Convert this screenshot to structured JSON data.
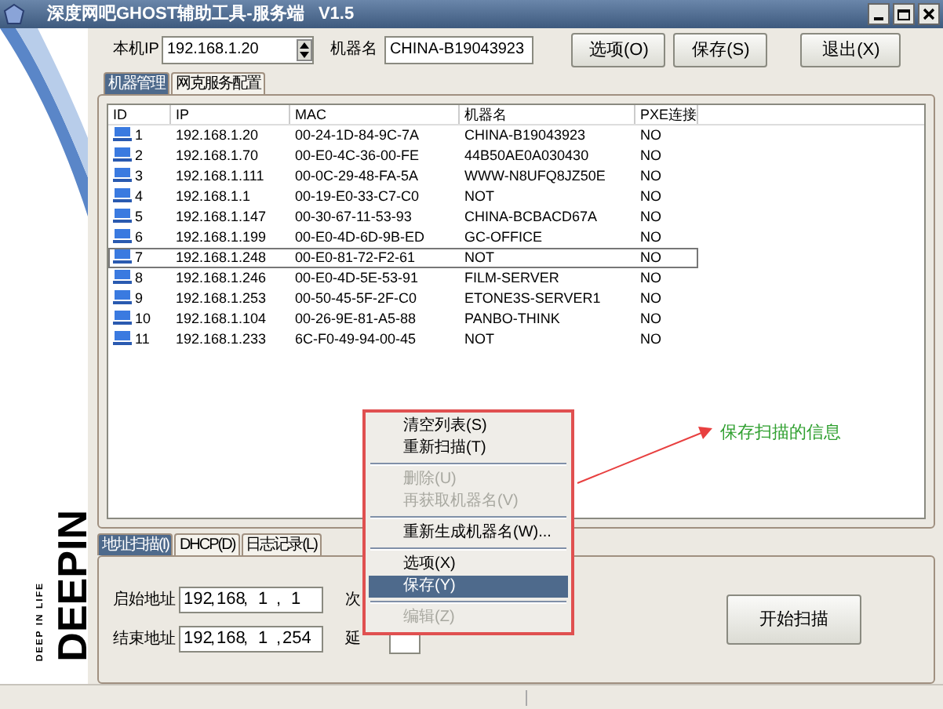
{
  "window": {
    "title": "深度网吧GHOST辅助工具-服务端   V1.5"
  },
  "banner": {
    "brand": "DEEPIN",
    "tagline": "DEEP IN LIFE"
  },
  "toolbar": {
    "local_ip_label": "本机IP",
    "local_ip": "192.168.1.20",
    "machine_name_label": "机器名",
    "machine_name": "CHINA-B19043923",
    "buttons": [
      "选项(O)",
      "保存(S)",
      "退出(X)"
    ]
  },
  "tabs": [
    {
      "label": "机器管理",
      "selected": true
    },
    {
      "label": "网克服务配置",
      "selected": false
    }
  ],
  "table": {
    "columns": [
      "ID",
      "IP",
      "MAC",
      "机器名",
      "PXE连接"
    ],
    "rows": [
      {
        "cells": [
          "1",
          "192.168.1.20",
          "00-24-1D-84-9C-7A",
          "CHINA-B19043923",
          "NO"
        ],
        "selected": false
      },
      {
        "cells": [
          "2",
          "192.168.1.70",
          "00-E0-4C-36-00-FE",
          "44B50AE0A030430",
          "NO"
        ],
        "selected": false
      },
      {
        "cells": [
          "3",
          "192.168.1.111",
          "00-0C-29-48-FA-5A",
          "WWW-N8UFQ8JZ50E",
          "NO"
        ],
        "selected": false
      },
      {
        "cells": [
          "4",
          "192.168.1.1",
          "00-19-E0-33-C7-C0",
          "NOT",
          "NO"
        ],
        "selected": false
      },
      {
        "cells": [
          "5",
          "192.168.1.147",
          "00-30-67-11-53-93",
          "CHINA-BCBACD67A",
          "NO"
        ],
        "selected": false
      },
      {
        "cells": [
          "6",
          "192.168.1.199",
          "00-E0-4D-6D-9B-ED",
          "GC-OFFICE",
          "NO"
        ],
        "selected": false
      },
      {
        "cells": [
          "7",
          "192.168.1.248",
          "00-E0-81-72-F2-61",
          "NOT",
          "NO"
        ],
        "selected": true
      },
      {
        "cells": [
          "8",
          "192.168.1.246",
          "00-E0-4D-5E-53-91",
          "FILM-SERVER",
          "NO"
        ],
        "selected": false
      },
      {
        "cells": [
          "9",
          "192.168.1.253",
          "00-50-45-5F-2F-C0",
          "ETONE3S-SERVER1",
          "NO"
        ],
        "selected": false
      },
      {
        "cells": [
          "10",
          "192.168.1.104",
          "00-26-9E-81-A5-88",
          "PANBO-THINK",
          "NO"
        ],
        "selected": false
      },
      {
        "cells": [
          "11",
          "192.168.1.233",
          "6C-F0-49-94-00-45",
          "NOT",
          "NO"
        ],
        "selected": false
      }
    ]
  },
  "context_menu": {
    "items": [
      {
        "kind": "item",
        "label": "清空列表(S)",
        "disabled": false,
        "selected": false
      },
      {
        "kind": "item",
        "label": "重新扫描(T)",
        "disabled": false,
        "selected": false
      },
      {
        "kind": "separator"
      },
      {
        "kind": "item",
        "label": "删除(U)",
        "disabled": true,
        "selected": false
      },
      {
        "kind": "item",
        "label": "再获取机器名(V)",
        "disabled": true,
        "selected": false
      },
      {
        "kind": "separator"
      },
      {
        "kind": "item",
        "label": "重新生成机器名(W)...",
        "disabled": false,
        "selected": false
      },
      {
        "kind": "separator"
      },
      {
        "kind": "item",
        "label": "选项(X)",
        "disabled": false,
        "selected": false
      },
      {
        "kind": "item",
        "label": "保存(Y)",
        "disabled": false,
        "selected": true
      },
      {
        "kind": "separator"
      },
      {
        "kind": "item",
        "label": "编辑(Z)",
        "disabled": true,
        "selected": false
      }
    ]
  },
  "annotation": {
    "note": "保存扫描的信息"
  },
  "scan_tabs": [
    {
      "label": "地址扫描(I)",
      "selected": true
    },
    {
      "label": "DHCP(D)",
      "selected": false
    },
    {
      "label": "日志记录(L)",
      "selected": false
    }
  ],
  "scan": {
    "start_label": "启始地址",
    "start_ip": [
      "192",
      ",",
      "168",
      ",",
      "1",
      ",",
      "1"
    ],
    "end_label": "结束地址",
    "end_ip": [
      "192",
      ",",
      "168",
      ",",
      "1",
      ",",
      "254"
    ],
    "times_label": "次",
    "delay_label": "延",
    "start_button": "开始扫描"
  }
}
